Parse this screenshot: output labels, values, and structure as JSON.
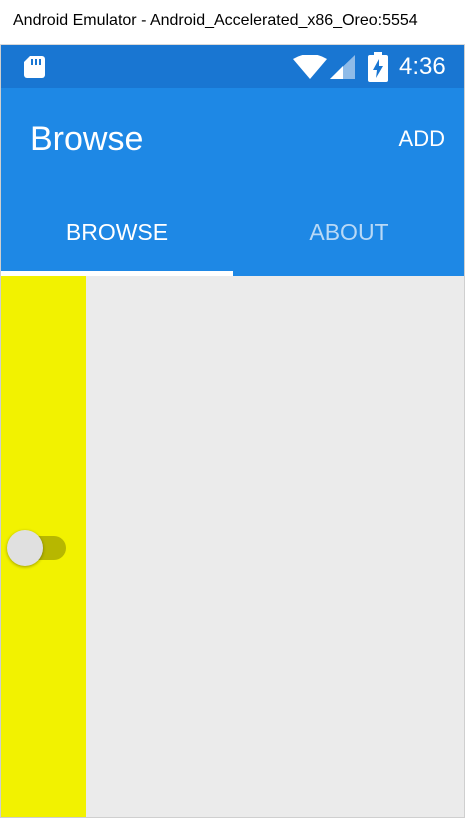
{
  "window": {
    "title": "Android Emulator - Android_Accelerated_x86_Oreo:5554"
  },
  "status_bar": {
    "time": "4:36",
    "icons": [
      "sd-card-icon",
      "wifi-icon",
      "signal-icon",
      "battery-charging-icon"
    ],
    "color": "#1976d2"
  },
  "toolbar": {
    "title": "Browse",
    "add_label": "ADD",
    "color": "#1e88e5"
  },
  "tabs": [
    {
      "label": "BROWSE",
      "selected": true
    },
    {
      "label": "ABOUT",
      "selected": false
    }
  ],
  "content": {
    "panel_color": "#f2f200",
    "background_color": "#ebebeb",
    "switch": {
      "on": false
    }
  }
}
